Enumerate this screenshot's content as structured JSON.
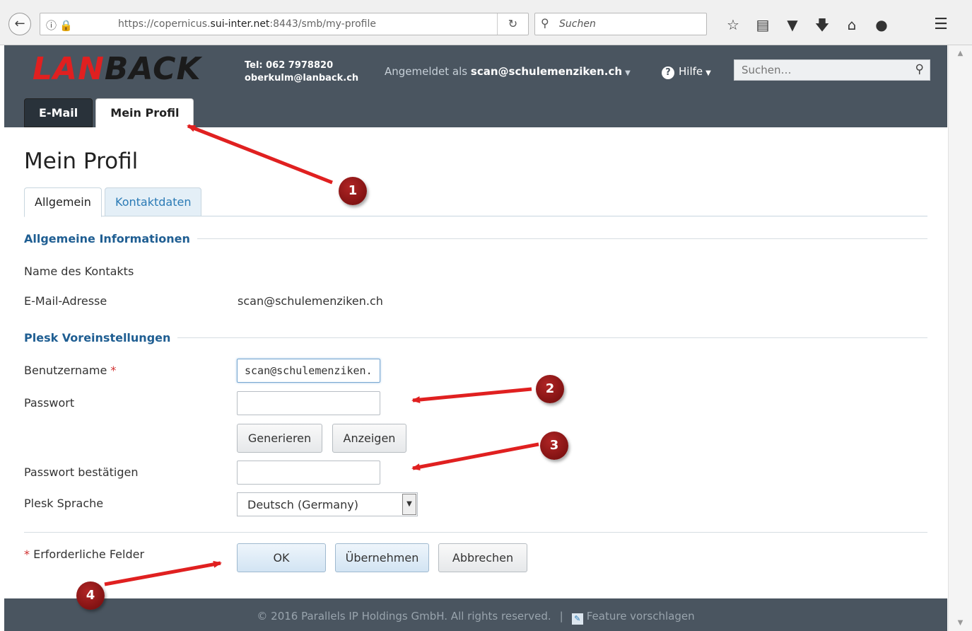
{
  "browser": {
    "url_prefix": "https://copernicus.",
    "url_host": "sui-inter.net",
    "url_suffix": ":8443/smb/my-profile",
    "search_placeholder": "Suchen",
    "toolbar_icons": [
      "star-icon",
      "reading-list-icon",
      "pocket-icon",
      "download-icon",
      "home-icon",
      "chat-icon",
      "menu-icon"
    ]
  },
  "header": {
    "logo_part1": "LAN",
    "logo_part2": "BACK",
    "phone": "Tel: 062 7978820",
    "email": "oberkulm@lanback.ch",
    "logged_in_prefix": "Angemeldet als",
    "logged_in_user": "scan@schulemenziken.ch",
    "help_label": "Hilfe",
    "search_placeholder": "Suchen…",
    "tabs": [
      {
        "label": "E-Mail",
        "active": false
      },
      {
        "label": "Mein Profil",
        "active": true
      }
    ]
  },
  "page": {
    "title": "Mein Profil",
    "subtabs": [
      {
        "label": "Allgemein",
        "active": true
      },
      {
        "label": "Kontaktdaten",
        "active": false
      }
    ],
    "general_section": {
      "title": "Allgemeine Informationen",
      "contact_name_label": "Name des Kontakts",
      "contact_name_value": "",
      "email_label": "E-Mail-Adresse",
      "email_value": "scan@schulemenziken.ch"
    },
    "plesk_section": {
      "title": "Plesk Voreinstellungen",
      "username_label": "Benutzername",
      "required_marker": "*",
      "username_value": "scan@schulemenziken.",
      "password_label": "Passwort",
      "password_value": "",
      "generate_button": "Generieren",
      "show_button": "Anzeigen",
      "confirm_password_label": "Passwort bestätigen",
      "confirm_password_value": "",
      "language_label": "Plesk Sprache",
      "language_value": "Deutsch (Germany)"
    },
    "required_note": "Erforderliche Felder",
    "buttons": {
      "ok": "OK",
      "apply": "Übernehmen",
      "cancel": "Abbrechen"
    }
  },
  "footer": {
    "copyright": "© 2016 Parallels IP Holdings GmbH. All rights reserved.",
    "separator": "|",
    "feature_link": "Feature vorschlagen"
  },
  "annotations": {
    "badges": [
      "1",
      "2",
      "3",
      "4"
    ],
    "arrow_color": "#e02020",
    "badge_color": "#8b1414"
  }
}
